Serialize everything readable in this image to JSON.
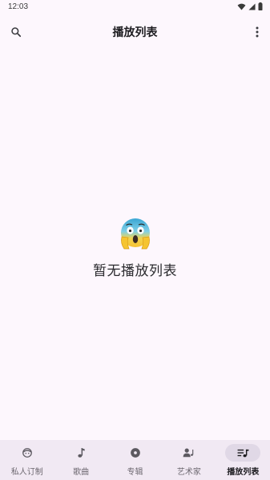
{
  "status_bar": {
    "time": "12:03"
  },
  "app_bar": {
    "title": "播放列表",
    "search_icon": "search-icon",
    "more_icon": "more-vert-icon"
  },
  "empty_state": {
    "emoji": "screaming-face-emoji",
    "message": "暂无播放列表"
  },
  "bottom_nav": {
    "items": [
      {
        "label": "私人订制",
        "icon": "face-icon",
        "active": false
      },
      {
        "label": "歌曲",
        "icon": "music-note-icon",
        "active": false
      },
      {
        "label": "专辑",
        "icon": "album-icon",
        "active": false
      },
      {
        "label": "艺术家",
        "icon": "artist-icon",
        "active": false
      },
      {
        "label": "播放列表",
        "icon": "playlist-icon",
        "active": true
      }
    ]
  },
  "colors": {
    "background": "#fdf7fd",
    "nav_background": "#f1e9f3",
    "active_indicator": "#e0d8e6"
  }
}
